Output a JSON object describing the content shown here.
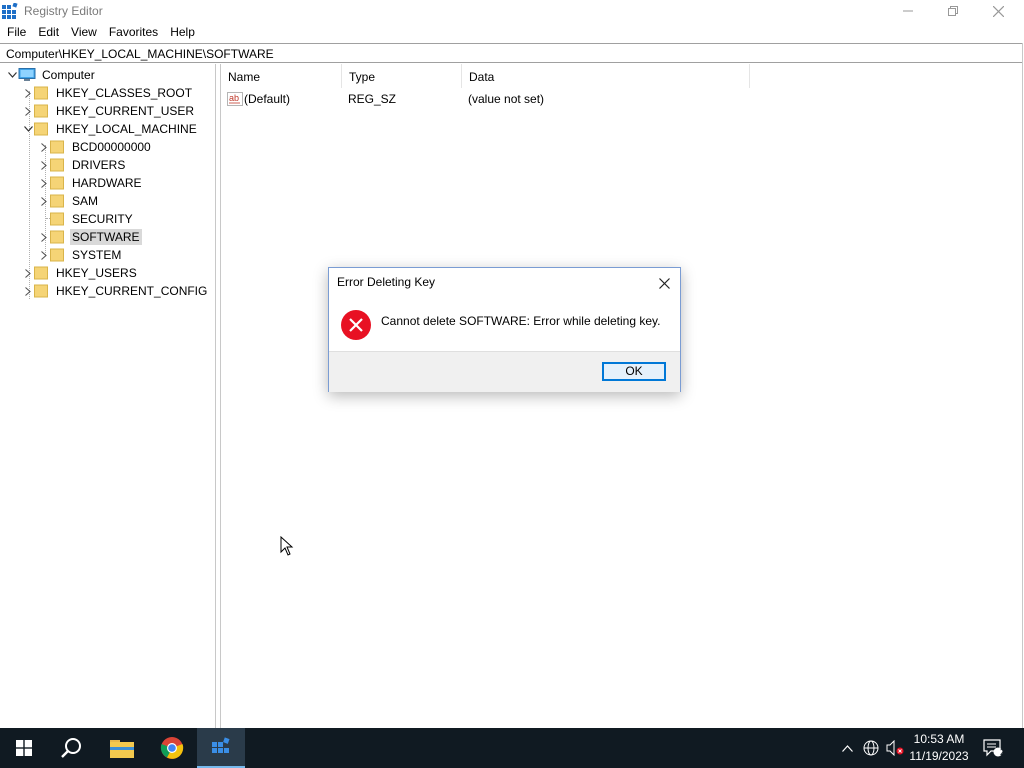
{
  "window": {
    "title": "Registry Editor",
    "icon": "registry-editor-icon"
  },
  "menu": {
    "items": [
      "File",
      "Edit",
      "View",
      "Favorites",
      "Help"
    ]
  },
  "address": {
    "path": "Computer\\HKEY_LOCAL_MACHINE\\SOFTWARE"
  },
  "tree": {
    "root": "Computer",
    "items": [
      {
        "label": "HKEY_CLASSES_ROOT",
        "level": 1,
        "expanded": false,
        "has_children": true
      },
      {
        "label": "HKEY_CURRENT_USER",
        "level": 1,
        "expanded": false,
        "has_children": true
      },
      {
        "label": "HKEY_LOCAL_MACHINE",
        "level": 1,
        "expanded": true,
        "has_children": true
      },
      {
        "label": "BCD00000000",
        "level": 2,
        "expanded": false,
        "has_children": true
      },
      {
        "label": "DRIVERS",
        "level": 2,
        "expanded": false,
        "has_children": true
      },
      {
        "label": "HARDWARE",
        "level": 2,
        "expanded": false,
        "has_children": true
      },
      {
        "label": "SAM",
        "level": 2,
        "expanded": false,
        "has_children": true
      },
      {
        "label": "SECURITY",
        "level": 2,
        "expanded": false,
        "has_children": false
      },
      {
        "label": "SOFTWARE",
        "level": 2,
        "expanded": false,
        "has_children": true,
        "selected": true
      },
      {
        "label": "SYSTEM",
        "level": 2,
        "expanded": false,
        "has_children": true
      },
      {
        "label": "HKEY_USERS",
        "level": 1,
        "expanded": false,
        "has_children": true
      },
      {
        "label": "HKEY_CURRENT_CONFIG",
        "level": 1,
        "expanded": false,
        "has_children": true
      }
    ]
  },
  "list": {
    "columns": [
      "Name",
      "Type",
      "Data"
    ],
    "rows": [
      {
        "name": "(Default)",
        "type": "REG_SZ",
        "data": "(value not set)",
        "icon": "string-value-icon"
      }
    ]
  },
  "dialog": {
    "title": "Error Deleting Key",
    "message": "Cannot delete SOFTWARE:  Error while deleting key.",
    "ok_label": "OK",
    "icon": "error-icon"
  },
  "taskbar": {
    "apps": [
      "start-icon",
      "search-icon",
      "file-explorer-icon",
      "chrome-icon",
      "registry-editor-icon"
    ],
    "time": "10:53 AM",
    "date": "11/19/2023",
    "notification_count": "2"
  },
  "colors": {
    "selection": "#d9d9d9",
    "accent": "#0078d7",
    "taskbar": "#101a22",
    "error": "#e81123",
    "folder": "#f5d476"
  }
}
